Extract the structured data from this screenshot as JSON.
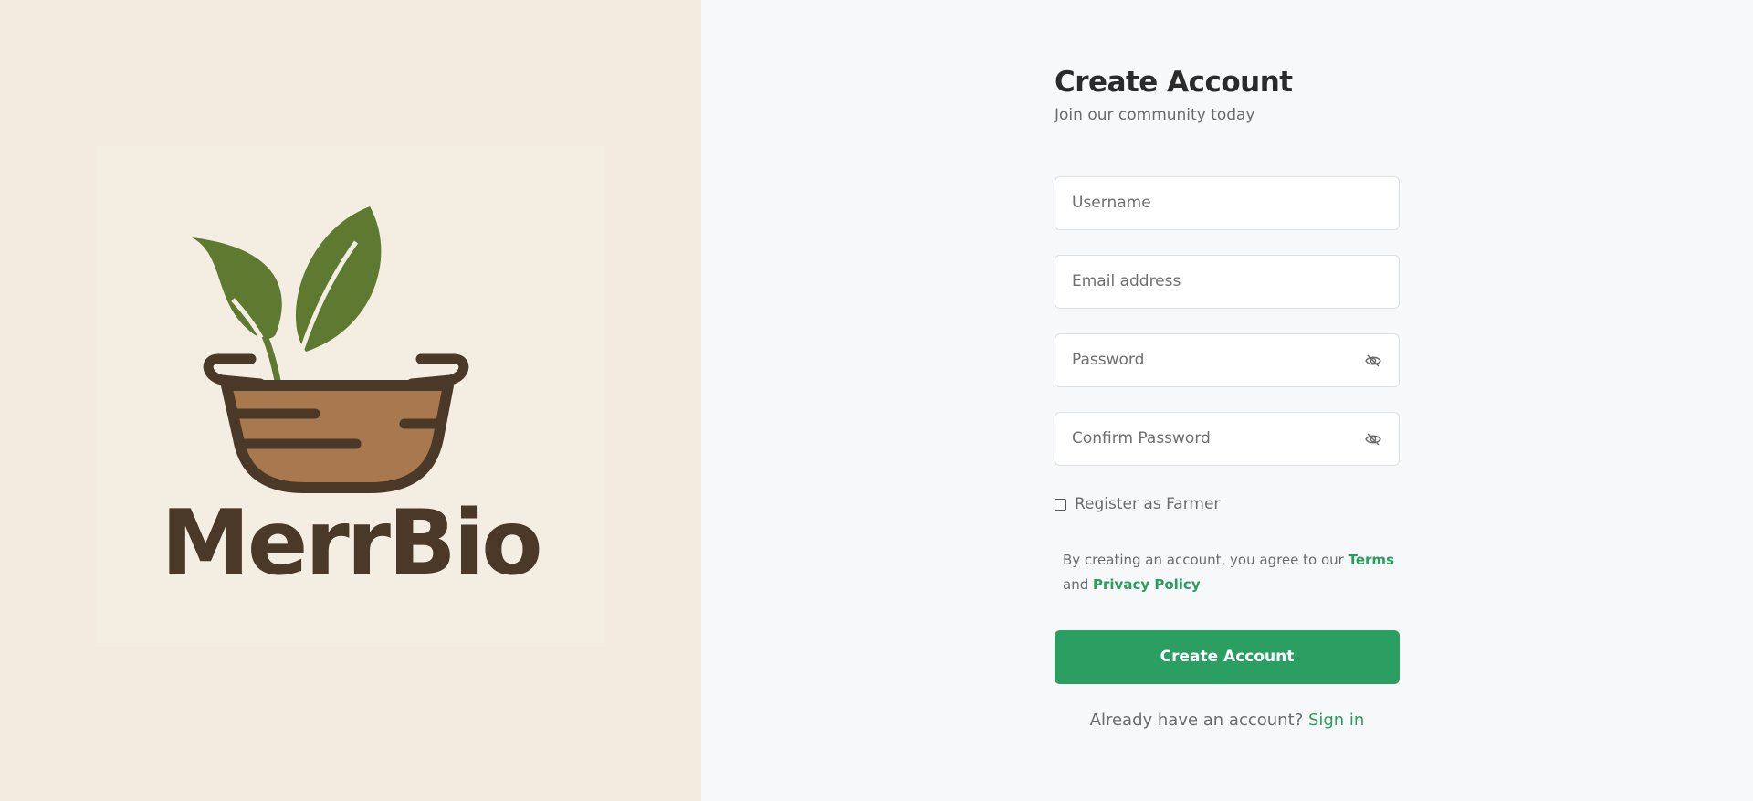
{
  "brand": {
    "name": "MerrBio",
    "colors": {
      "leaf": "#5e7a30",
      "basket": "#4a3828",
      "soil": "#a8784e",
      "panel": "#f3ebe0"
    }
  },
  "form": {
    "title": "Create Account",
    "subtitle": "Join our community today",
    "username_placeholder": "Username",
    "email_placeholder": "Email address",
    "password_placeholder": "Password",
    "confirm_password_placeholder": "Confirm Password",
    "password_toggle_icon": "eye-off-icon",
    "farmer_checkbox_label": "Register as Farmer",
    "farmer_checked": false,
    "terms_prefix": "By creating an account, you agree to our",
    "terms_link": "Terms",
    "terms_and": "and",
    "privacy_link": "Privacy Policy",
    "submit_label": "Create Account",
    "signin_prompt": "Already have an account?",
    "signin_link": "Sign in"
  },
  "colors": {
    "accent": "#2a9f61",
    "link": "#2a9d5d",
    "text_muted": "#6b6b6b",
    "title": "#2b2b2b"
  }
}
